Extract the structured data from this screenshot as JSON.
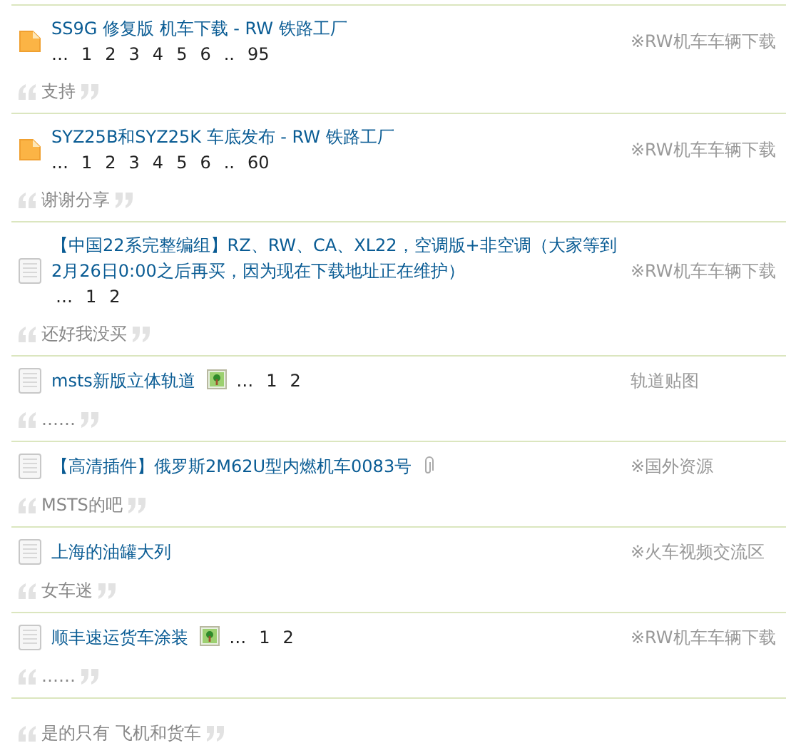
{
  "entries": [
    {
      "thread": {
        "kind": "folder",
        "title": "SS9G 修复版 机车下载 - RW 铁路工厂",
        "pages_inline": false,
        "pages": [
          "…",
          "1",
          "2",
          "3",
          "4",
          "5",
          "6",
          "..",
          "95"
        ],
        "forum": "※RW机车车辆下载"
      },
      "quote": "支持"
    },
    {
      "thread": {
        "kind": "folder",
        "title": "SYZ25B和SYZ25K 车底发布 - RW 铁路工厂",
        "pages_inline": false,
        "pages": [
          "…",
          "1",
          "2",
          "3",
          "4",
          "5",
          "6",
          "..",
          "60"
        ],
        "forum": "※RW机车车辆下载"
      },
      "quote": "谢谢分享"
    },
    {
      "thread": {
        "kind": "doc",
        "title": "【中国22系完整编组】RZ、RW、CA、XL22，空调版+非空调（大家等到2月26日0:00之后再买，因为现在下载地址正在维护）",
        "pages_inline": true,
        "pages": [
          "…",
          "1",
          "2"
        ],
        "forum": "※RW机车车辆下载"
      },
      "quote": "还好我没买"
    },
    {
      "thread": {
        "kind": "doc",
        "title": "msts新版立体轨道",
        "attachment": {
          "kind": "image"
        },
        "pages_inline": true,
        "pages": [
          "…",
          "1",
          "2"
        ],
        "forum": "轨道贴图"
      },
      "quote": "……"
    },
    {
      "thread": {
        "kind": "doc",
        "title": "【高清插件】俄罗斯2M62U型内燃机车0083号",
        "attachment": {
          "kind": "clip"
        },
        "forum": "※国外资源"
      },
      "quote": "MSTS的吧"
    },
    {
      "thread": {
        "kind": "doc",
        "title": "上海的油罐大列",
        "forum": "※火车视频交流区"
      },
      "quote": "女车迷"
    },
    {
      "thread": {
        "kind": "doc",
        "title": "顺丰速运货车涂装",
        "attachment": {
          "kind": "image"
        },
        "pages_inline": true,
        "pages": [
          "…",
          "1",
          "2"
        ],
        "forum": "※RW机车车辆下载"
      },
      "quote": "……"
    },
    {
      "quote": "是的只有 飞机和货车"
    }
  ]
}
